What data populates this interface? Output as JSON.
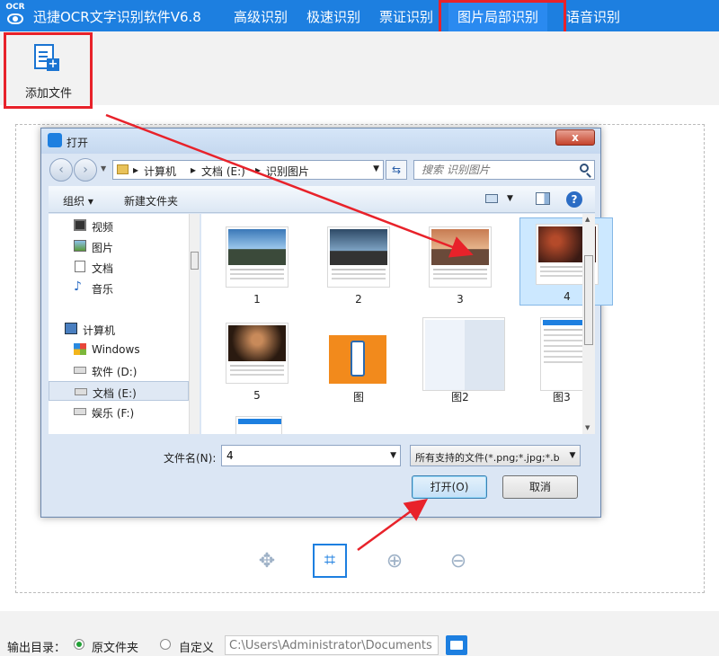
{
  "app": {
    "logo_text": "OCR",
    "title": "迅捷OCR文字识别软件V6.8",
    "nav_tabs": [
      "高级识别",
      "极速识别",
      "票证识别",
      "图片局部识别",
      "语音识别"
    ],
    "active_tab": "图片局部识别",
    "brand_color": "#1d7fe0"
  },
  "toolbar": {
    "add_file_label": "添加文件",
    "add_file_icon": "add-document-icon"
  },
  "dialog": {
    "title": "打开",
    "close_label": "x",
    "breadcrumb": [
      "计算机",
      "文档 (E:)",
      "识别图片"
    ],
    "search_placeholder": "搜索 识别图片",
    "commands": {
      "organize": "组织 ▾",
      "new_folder": "新建文件夹"
    },
    "nav_items": [
      {
        "label": "视频",
        "icon": "video-icon"
      },
      {
        "label": "图片",
        "icon": "pictures-icon"
      },
      {
        "label": "文档",
        "icon": "documents-icon"
      },
      {
        "label": "音乐",
        "icon": "music-icon"
      },
      {
        "label": "计算机",
        "icon": "computer-icon"
      },
      {
        "label": "Windows",
        "icon": "windows-drive-icon"
      },
      {
        "label": "软件 (D:)",
        "icon": "drive-icon"
      },
      {
        "label": "文档 (E:)",
        "icon": "drive-icon",
        "selected": true
      },
      {
        "label": "娱乐 (F:)",
        "icon": "drive-icon"
      }
    ],
    "files": [
      {
        "label": "1"
      },
      {
        "label": "2"
      },
      {
        "label": "3"
      },
      {
        "label": "4",
        "selected": true
      },
      {
        "label": "5"
      },
      {
        "label": "图"
      },
      {
        "label": "图2"
      },
      {
        "label": "图3"
      },
      {
        "label": ""
      }
    ],
    "filename_label": "文件名(N):",
    "filename_value": "4",
    "filetype_value": "所有支持的文件(*.png;*.jpg;*.b",
    "open_button": "打开(O)",
    "cancel_button": "取消"
  },
  "image_tools": [
    "move-icon",
    "crop-icon",
    "zoom-in-icon",
    "zoom-out-icon"
  ],
  "bottom": {
    "output_label": "输出目录：",
    "option_original": "原文件夹",
    "option_custom": "自定义",
    "selected_option": "原文件夹",
    "path_value": "C:\\Users\\Administrator\\Documents"
  },
  "annotation_color": "#e8222a"
}
